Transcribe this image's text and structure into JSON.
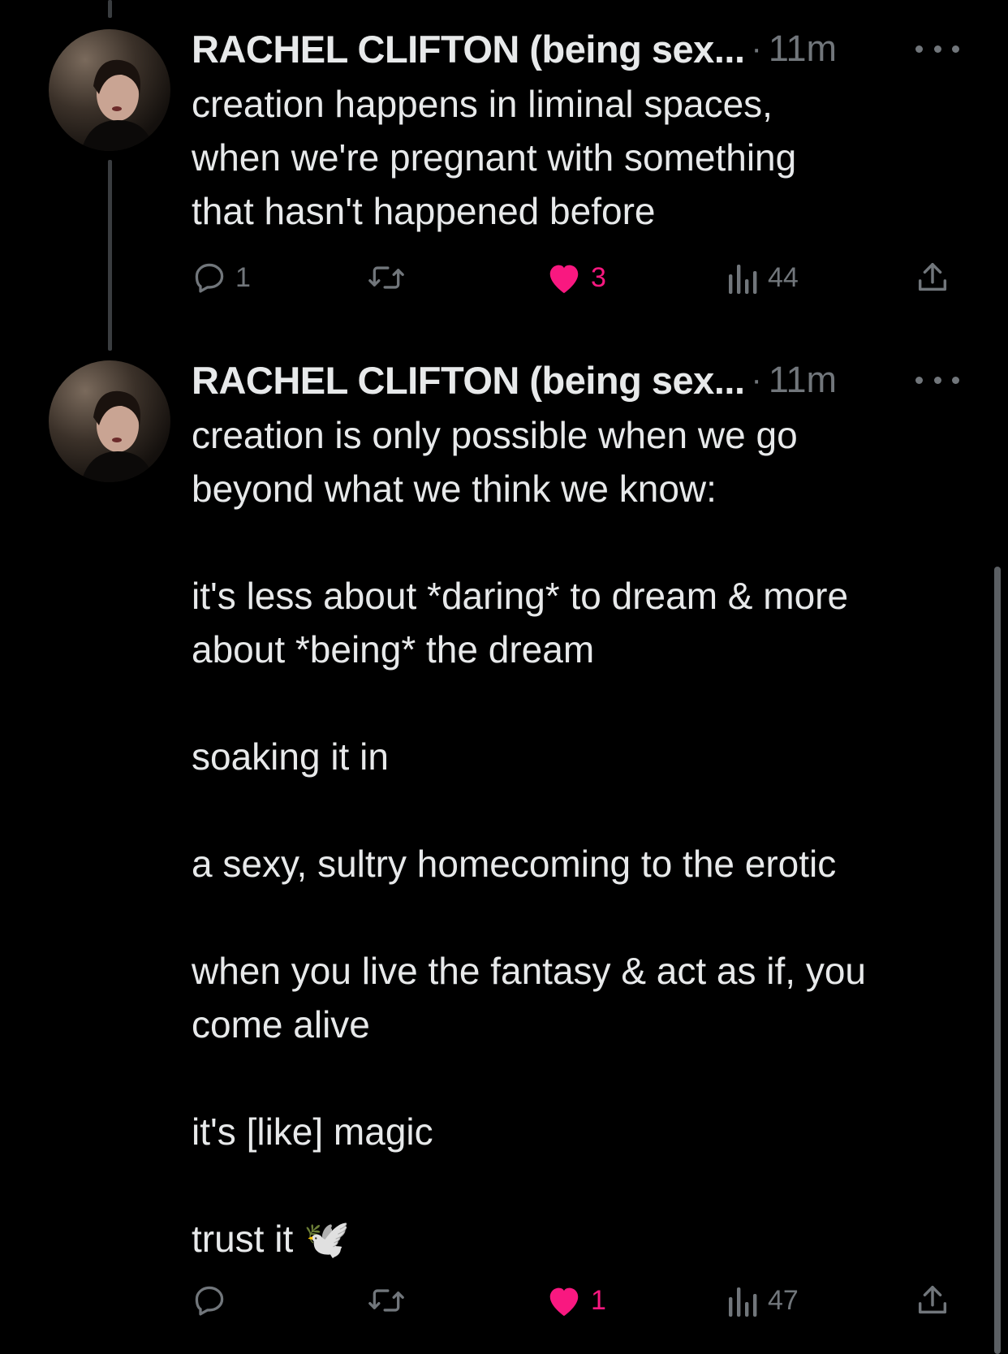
{
  "colors": {
    "background": "#000000",
    "text": "#e7e9ea",
    "muted": "#71767b",
    "like_active": "#f91880",
    "thread_line": "#3a3d40"
  },
  "tweets": [
    {
      "author": "RACHEL CLIFTON (being sex...",
      "separator": "·",
      "time": "11m",
      "text": "creation happens in liminal spaces,\nwhen we're pregnant with something\nthat hasn't happened before",
      "actions": {
        "reply": {
          "icon": "reply-icon",
          "count": "1"
        },
        "retweet": {
          "icon": "retweet-icon",
          "count": ""
        },
        "like": {
          "icon": "heart-filled-icon",
          "count": "3",
          "liked": true
        },
        "views": {
          "icon": "views-icon",
          "count": "44"
        },
        "share": {
          "icon": "share-icon"
        }
      }
    },
    {
      "author": "RACHEL CLIFTON (being sex...",
      "separator": "·",
      "time": "11m",
      "text": "creation is only possible when we go\nbeyond what we think we know:\n\nit's less about *daring* to dream & more\nabout *being* the dream\n\nsoaking it in\n\na sexy, sultry homecoming to the erotic\n\nwhen you live the fantasy & act as if, you\ncome alive\n\nit's [like] magic\n\ntrust it 🕊️",
      "actions": {
        "reply": {
          "icon": "reply-icon",
          "count": ""
        },
        "retweet": {
          "icon": "retweet-icon",
          "count": ""
        },
        "like": {
          "icon": "heart-filled-icon",
          "count": "1",
          "liked": true
        },
        "views": {
          "icon": "views-icon",
          "count": "47"
        },
        "share": {
          "icon": "share-icon"
        }
      }
    }
  ]
}
